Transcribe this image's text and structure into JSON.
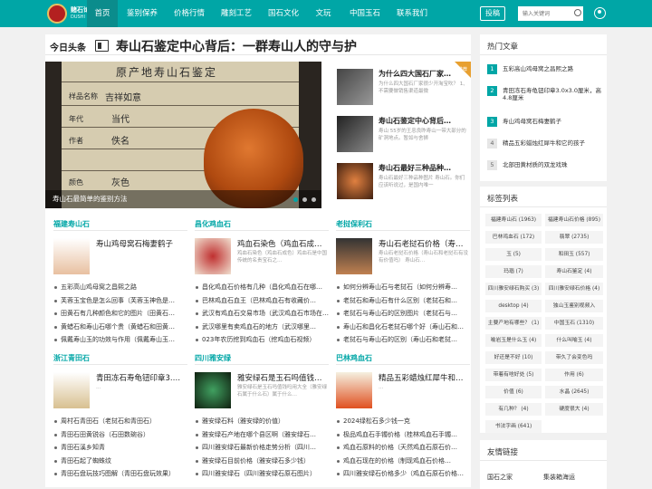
{
  "brand": {
    "name": "赌石论坛",
    "sub": "DUSHI LUNTAN"
  },
  "nav": {
    "items": [
      "首页",
      "鉴别保养",
      "价格行情",
      "雕刻工艺",
      "国石文化",
      "文玩",
      "中国玉石",
      "联系我们"
    ],
    "contribute": "投稿",
    "search_placeholder": "输入关键词"
  },
  "headline": {
    "source": "今日头条",
    "title": "寿山石鉴定中心背后：一群寿山人的守与护"
  },
  "slider": {
    "board_title": "原产地寿山石鉴定",
    "fields": [
      {
        "label": "样品名称",
        "value": "吉祥如意"
      },
      {
        "label": "年代",
        "value": "当代"
      },
      {
        "label": "作者",
        "value": "佚名"
      },
      {
        "label": "颜色",
        "value": "灰色"
      }
    ],
    "caption": "寿山石最简单的鉴别方法"
  },
  "side_news": [
    {
      "title": "为什么四大国石厂家…",
      "desc": "为什么四大国石厂家很少开淘宝吹？ 1、不需要做销售渠道最微"
    },
    {
      "title": "寿山石鉴定中心背后…",
      "desc": "寿山 55岁的王忠良昨寿山一带大部分的矿洞地点。暂如与舍狮"
    },
    {
      "title": "寿山石最好三种品种…",
      "desc": "寿山石最好三种品种图片 寿山石。你们应该听说过，是国内唯一"
    }
  ],
  "ribbon": "推荐",
  "categories": [
    {
      "name": "福建寿山石",
      "feature_title": "寿山鸡母窝石梅妻鹤子",
      "feature_desc": "",
      "items": [
        "五彩高山鸡母窝之昌熙之路",
        "芙蓉玉宝色是怎么回事（芙蓉玉神色是…",
        "田黄石有几种颜色和它的图片（田黄石…",
        "黄蜡石和寿山石哪个贵（黄蜡石和田黄…",
        "佩戴寿山玉的功效与作用（佩戴寿山玉…"
      ]
    },
    {
      "name": "昌化鸡血石",
      "feature_title": "鸡血石染色（鸡血石成…",
      "feature_desc": "鸡血石染色（鸡血石成色）鸡血石是中国传统的名贵宝石之…",
      "items": [
        "昌化鸡血石价格有几种（昌化鸡血石在哪…",
        "巴林鸡血石血王（巴林鸡血石有收藏价…",
        "武汉有鸡血石交易市场（武汉鸡血石市场在…",
        "武汉哪里有卖鸡血石的地方（武汉哪里…",
        "023年农历挖到鸡血石（挖鸡血石视频）"
      ]
    },
    {
      "name": "老挝保利石",
      "feature_title": "寿山石老挝石价格（寿…",
      "feature_desc": "寿山石老挝石价格（寿山石和老挝石有没有价值吗） 寿山石…",
      "items": [
        "如何分辨寿山石与老挝石（如何分辨寿…",
        "老挝石和寿山石有什么区别（老挝石和…",
        "老挝石与寿山石的区别图片（老挝石与…",
        "寿山石和昌化石老挝石哪个好（寿山石和…",
        "老挝石与寿山石的区别（寿山石和老挝…"
      ]
    },
    {
      "name": "浙江青田石",
      "feature_title": "青田冻石寿龟钮印章3.…",
      "feature_desc": "…",
      "items": [
        "周村石青田石（老挝石和青田石）",
        "青田石田黄锐谷（石田数碗谷）",
        "青田石溪乡知青",
        "青田石起了蜘蛛纹",
        "青田石盘玩技巧图解（青田石盘玩效果）"
      ]
    },
    {
      "name": "四川雅安绿",
      "feature_title": "雅安绿石是玉石吗值钱…",
      "feature_desc": "雅安绿石是玉石吗值钱吗用大全（雅安绿石属于什么石）属于什么…",
      "items": [
        "雅安绿石料（雅安绿的价值）",
        "雅安绿石产地在哪个县区啊（雅安绿石…",
        "四川雅安绿石最新价格走势分析（四川…",
        "雅安绿石目前价格（雅安绿石多少钱）",
        "四川雅安绿石（四川雅安绿石原石图片）"
      ]
    },
    {
      "name": "巴林鸡血石",
      "feature_title": "精品五彩蜡烛红犀牛和…",
      "feature_desc": "…",
      "items": [
        "2024绿松石多少钱一克",
        "极品鸡血石手镯价格（桂林鸡血石手镯…",
        "鸡血石原料的价格（天然鸡血石原石价…",
        "鸡血石现在的价格（制现鸡血石价格…",
        "四川雅安绿石价格多少（鸡血石原石价格…"
      ]
    }
  ],
  "hot": {
    "title": "热门文章",
    "items": [
      "五彩高山鸡母窝之昌熙之路",
      "青田冻石寿龟钮印章3.0x3.0厘米，高4.8厘米",
      "寿山鸡母窝石梅妻鹤子",
      "精品五彩蜡烛红犀牛和它的孩子",
      "北部田黄材质的双龙戏珠"
    ]
  },
  "tags": {
    "title": "标签列表",
    "items": [
      "福建寿山石 (1963)",
      "福建寿山石价格 (895)",
      "巴林鸡血石 (172)",
      "翡翠 (2735)",
      "玉 (5)",
      "和田玉 (557)",
      "玛瑙 (7)",
      "寿山石鉴定 (4)",
      "四川雅安绿石购买 (3)",
      "四川雅安绿石价格 (4)",
      "desktop (4)",
      "独山玉鉴别视频入",
      "主要产地有哪些？ (1)",
      "中国玉石 (1310)",
      "喻岩玉是什么玉 (4)",
      "什么叫喻玉 (4)",
      "好还是不好 (10)",
      "带久了会变色吗",
      "带着有啥好处 (5)",
      "作用 (6)",
      "价值 (6)",
      "水晶 (2645)",
      "有几种？ (4)",
      "硬度很大 (4)",
      "书法字画 (641)"
    ]
  },
  "links": {
    "title": "友情链接",
    "items": [
      "国石之家",
      "集装箱海运"
    ]
  },
  "colors": {
    "accent": "#00a6a6",
    "nav_active": "#0b8c8c"
  }
}
